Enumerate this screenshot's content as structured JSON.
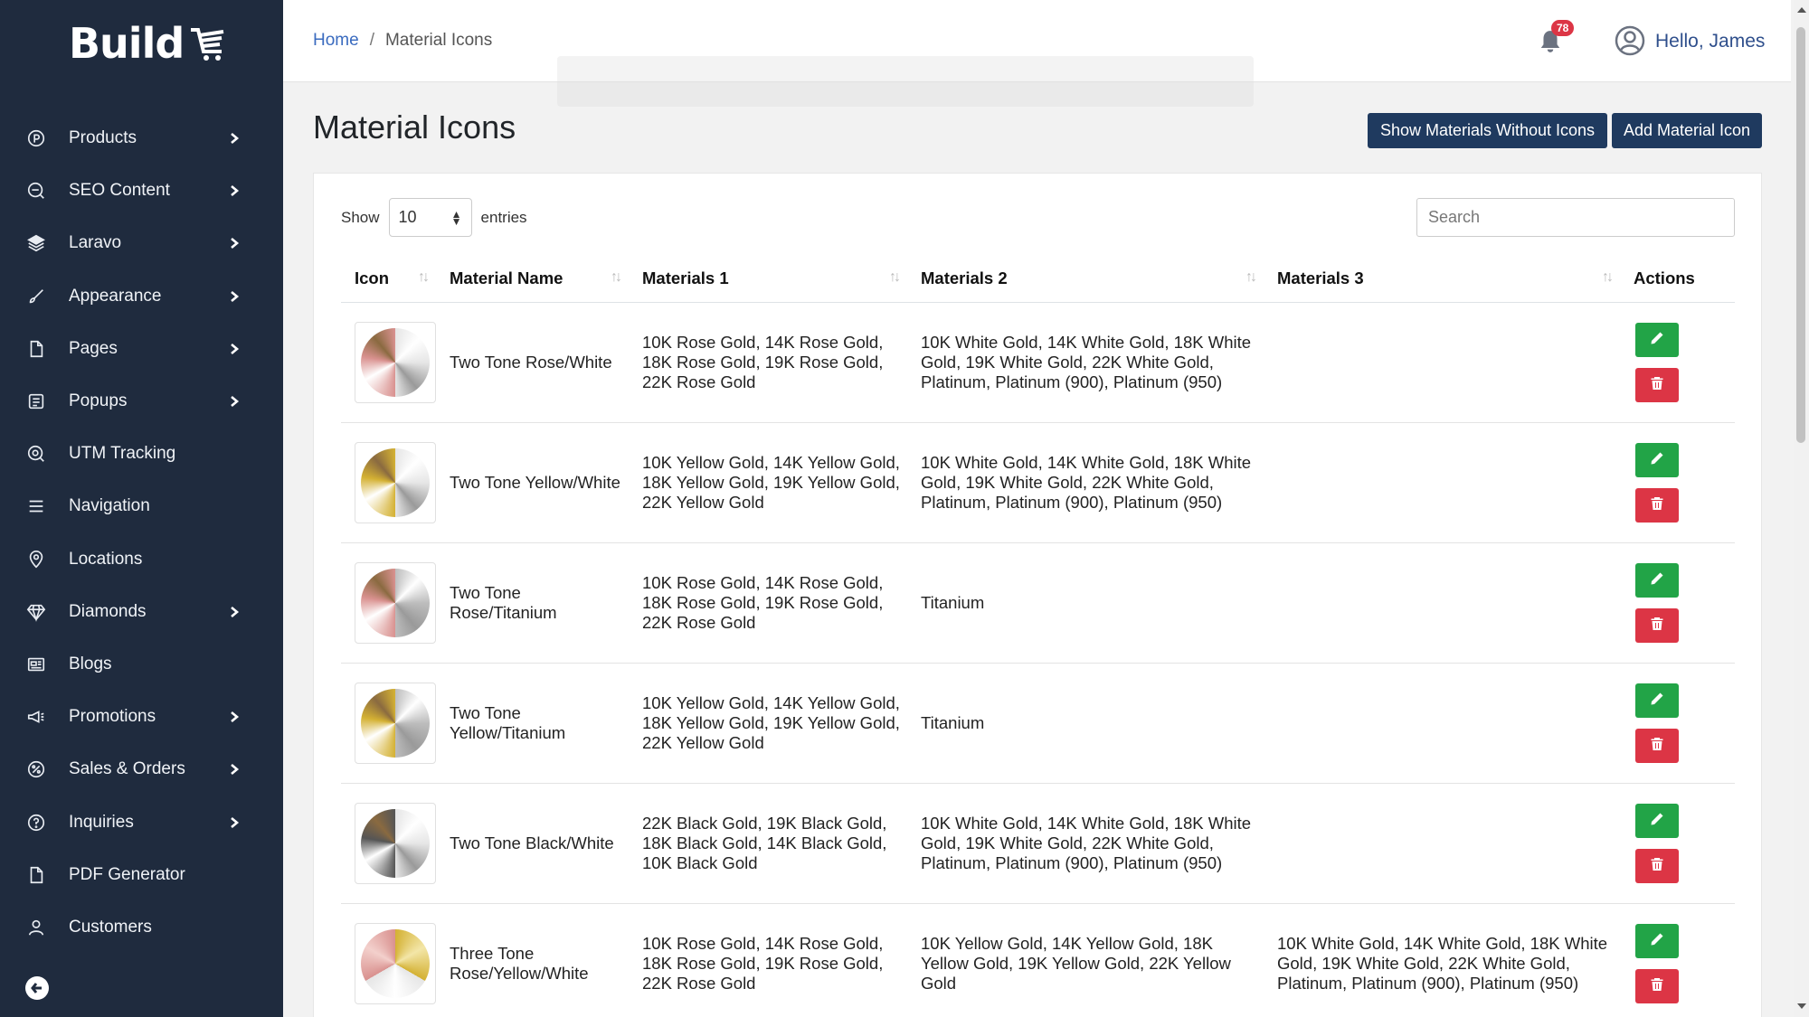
{
  "app": {
    "logo_text": "Build"
  },
  "sidebar": {
    "items": [
      {
        "label": "Products",
        "icon": "product-circle-icon",
        "chevron": true
      },
      {
        "label": "SEO Content",
        "icon": "seo-icon",
        "chevron": true
      },
      {
        "label": "Laravo",
        "icon": "layers-icon",
        "chevron": true
      },
      {
        "label": "Appearance",
        "icon": "brush-icon",
        "chevron": true
      },
      {
        "label": "Pages",
        "icon": "page-icon",
        "chevron": true
      },
      {
        "label": "Popups",
        "icon": "popup-icon",
        "chevron": true
      },
      {
        "label": "UTM Tracking",
        "icon": "utm-icon",
        "chevron": false
      },
      {
        "label": "Navigation",
        "icon": "menu-icon",
        "chevron": false
      },
      {
        "label": "Locations",
        "icon": "location-pin-icon",
        "chevron": false
      },
      {
        "label": "Diamonds",
        "icon": "diamond-icon",
        "chevron": true
      },
      {
        "label": "Blogs",
        "icon": "newspaper-icon",
        "chevron": false
      },
      {
        "label": "Promotions",
        "icon": "megaphone-icon",
        "chevron": true
      },
      {
        "label": "Sales & Orders",
        "icon": "percent-badge-icon",
        "chevron": true
      },
      {
        "label": "Inquiries",
        "icon": "question-icon",
        "chevron": true
      },
      {
        "label": "PDF Generator",
        "icon": "document-icon",
        "chevron": false
      },
      {
        "label": "Customers",
        "icon": "user-icon",
        "chevron": false
      }
    ]
  },
  "topbar": {
    "breadcrumb": {
      "home": "Home",
      "separator": "/",
      "current": "Material Icons"
    },
    "notification_count": "78",
    "greeting": "Hello, James"
  },
  "page": {
    "title": "Material Icons",
    "show_without_icons_label": "Show Materials Without Icons",
    "add_label": "Add Material Icon"
  },
  "table_controls": {
    "show_label": "Show",
    "entries_value": "10",
    "entries_label": "entries",
    "search_placeholder": "Search"
  },
  "table": {
    "headers": [
      "Icon",
      "Material Name",
      "Materials 1",
      "Materials 2",
      "Materials 3",
      "Actions"
    ],
    "rows": [
      {
        "name": "Two Tone Rose/White",
        "colors": [
          "#d9918f",
          "#e6e6e6"
        ],
        "m1": "10K Rose Gold, 14K Rose Gold, 18K Rose Gold, 19K Rose Gold, 22K Rose Gold",
        "m2": "10K White Gold, 14K White Gold, 18K White Gold, 19K White Gold, 22K White Gold, Platinum, Platinum (900), Platinum (950)",
        "m3": ""
      },
      {
        "name": "Two Tone Yellow/White",
        "colors": [
          "#d4b133",
          "#e6e6e6"
        ],
        "m1": "10K Yellow Gold, 14K Yellow Gold, 18K Yellow Gold, 19K Yellow Gold, 22K Yellow Gold",
        "m2": "10K White Gold, 14K White Gold, 18K White Gold, 19K White Gold, 22K White Gold, Platinum, Platinum (900), Platinum (950)",
        "m3": ""
      },
      {
        "name": "Two Tone Rose/Titanium",
        "colors": [
          "#d9918f",
          "#bdbdbd"
        ],
        "m1": "10K Rose Gold, 14K Rose Gold, 18K Rose Gold, 19K Rose Gold, 22K Rose Gold",
        "m2": "Titanium",
        "m3": ""
      },
      {
        "name": "Two Tone Yellow/Titanium",
        "colors": [
          "#d4b133",
          "#bdbdbd"
        ],
        "m1": "10K Yellow Gold, 14K Yellow Gold, 18K Yellow Gold, 19K Yellow Gold, 22K Yellow Gold",
        "m2": "Titanium",
        "m3": ""
      },
      {
        "name": "Two Tone Black/White",
        "colors": [
          "#555555",
          "#e6e6e6"
        ],
        "m1": "22K Black Gold, 19K Black Gold, 18K Black Gold, 14K Black Gold, 10K Black Gold",
        "m2": "10K White Gold, 14K White Gold, 18K White Gold, 19K White Gold, 22K White Gold, Platinum, Platinum (900), Platinum (950)",
        "m3": ""
      },
      {
        "name": "Three Tone Rose/Yellow/White",
        "colors": [
          "#d9918f",
          "#d4b133",
          "#e6e6e6"
        ],
        "m1": "10K Rose Gold, 14K Rose Gold, 18K Rose Gold, 19K Rose Gold, 22K Rose Gold",
        "m2": "10K Yellow Gold, 14K Yellow Gold, 18K Yellow Gold, 19K Yellow Gold, 22K Yellow Gold",
        "m3": "10K White Gold, 14K White Gold, 18K White Gold, 19K White Gold, 22K White Gold, Platinum, Platinum (900), Platinum (950)"
      }
    ]
  },
  "colors": {
    "sidebar_bg": "#1f2b3e",
    "primary_button": "#1f3a5f",
    "edit": "#22a447",
    "delete": "#dc3545",
    "link": "#3a6bbf"
  }
}
